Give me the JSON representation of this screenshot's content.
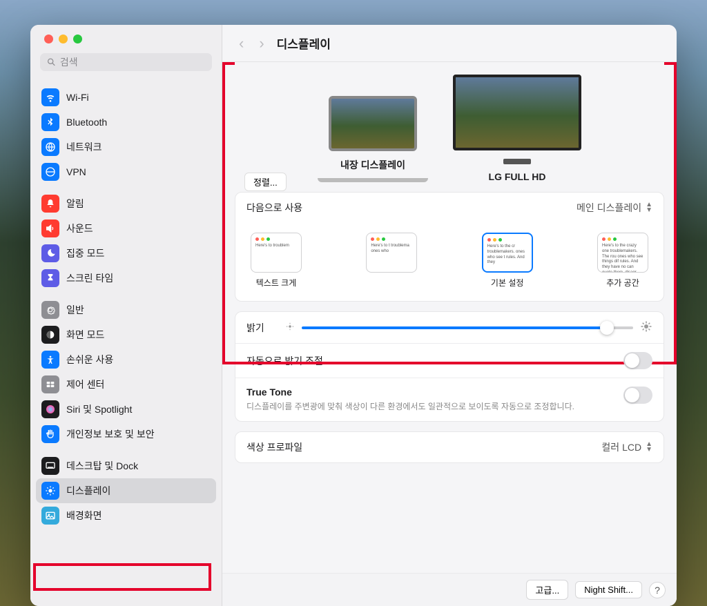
{
  "search": {
    "placeholder": "검색"
  },
  "page_title": "디스플레이",
  "sidebar": {
    "groups": [
      [
        {
          "label": "Wi-Fi",
          "icon": "wifi",
          "color": "blue"
        },
        {
          "label": "Bluetooth",
          "icon": "bluetooth",
          "color": "blue"
        },
        {
          "label": "네트워크",
          "icon": "network",
          "color": "blue"
        },
        {
          "label": "VPN",
          "icon": "vpn",
          "color": "blue"
        }
      ],
      [
        {
          "label": "알림",
          "icon": "bell",
          "color": "red"
        },
        {
          "label": "사운드",
          "icon": "speaker",
          "color": "red"
        },
        {
          "label": "집중 모드",
          "icon": "moon",
          "color": "purple"
        },
        {
          "label": "스크린 타임",
          "icon": "hourglass",
          "color": "purple"
        }
      ],
      [
        {
          "label": "일반",
          "icon": "gear",
          "color": "gray"
        },
        {
          "label": "화면 모드",
          "icon": "appearance",
          "color": "dark"
        },
        {
          "label": "손쉬운 사용",
          "icon": "accessibility",
          "color": "blue"
        },
        {
          "label": "제어 센터",
          "icon": "control",
          "color": "gray"
        },
        {
          "label": "Siri 및 Spotlight",
          "icon": "siri",
          "color": "dark"
        },
        {
          "label": "개인정보 보호 및 보안",
          "icon": "hand",
          "color": "blue"
        }
      ],
      [
        {
          "label": "데스크탑 및 Dock",
          "icon": "dock",
          "color": "dark"
        },
        {
          "label": "디스플레이",
          "icon": "brightness",
          "color": "blue",
          "selected": true
        },
        {
          "label": "배경화면",
          "icon": "wallpaper",
          "color": "lightblue"
        }
      ]
    ]
  },
  "arrange_button": "정렬...",
  "displays": [
    {
      "label": "내장 디스플레이",
      "type": "laptop"
    },
    {
      "label": "LG FULL HD",
      "type": "external"
    }
  ],
  "use_as": {
    "label": "다음으로 사용",
    "value": "메인 디스플레이"
  },
  "resolutions": [
    {
      "label": "텍스트 크게",
      "sample": "Here's to troublem",
      "selected": false
    },
    {
      "label": "",
      "sample": "Here's to t troublema ones who",
      "selected": false
    },
    {
      "label": "기본 설정",
      "sample": "Here's to the cr troublemakers. ones who see t rules. And they",
      "selected": true
    },
    {
      "label": "추가 공간",
      "sample": "Here's to the crazy one troublemakers. The rou ones who see things dif rules. And they have no can quote them, disagr them. About the only th Because they change t",
      "selected": false
    }
  ],
  "brightness": {
    "label": "밝기"
  },
  "auto_brightness": {
    "label": "자동으로 밝기 조절"
  },
  "true_tone": {
    "label": "True Tone",
    "desc": "디스플레이를 주변광에 맞춰 색상이 다른 환경에서도 일관적으로 보이도록 자동으로 조정합니다."
  },
  "color_profile": {
    "label": "색상 프로파일",
    "value": "컬러 LCD"
  },
  "bottom_buttons": {
    "advanced": "고급...",
    "night_shift": "Night Shift..."
  }
}
